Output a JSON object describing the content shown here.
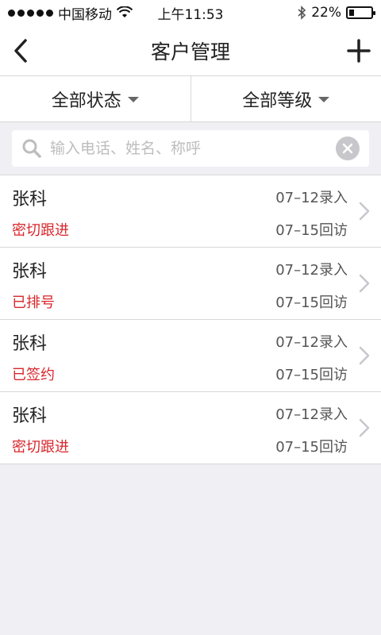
{
  "status_bar": {
    "carrier": "中国移动",
    "time": "上午11:53",
    "battery": "22%",
    "battery_level": 0.22
  },
  "nav": {
    "title": "客户管理",
    "back_icon": "chevron-left-icon",
    "add_icon": "plus-icon"
  },
  "filters": {
    "status_label": "全部状态",
    "level_label": "全部等级"
  },
  "search": {
    "placeholder": "输入电话、姓名、称呼",
    "value": ""
  },
  "customers": [
    {
      "name": "张科",
      "status": "密切跟进",
      "entry": "07–12录入",
      "visit": "07–15回访"
    },
    {
      "name": "张科",
      "status": "已排号",
      "entry": "07–12录入",
      "visit": "07–15回访"
    },
    {
      "name": "张科",
      "status": "已签约",
      "entry": "07–12录入",
      "visit": "07–15回访"
    },
    {
      "name": "张科",
      "status": "密切跟进",
      "entry": "07–12录入",
      "visit": "07–15回访"
    }
  ],
  "colors": {
    "status_red": "#d9262c",
    "background": "#efeff4"
  }
}
